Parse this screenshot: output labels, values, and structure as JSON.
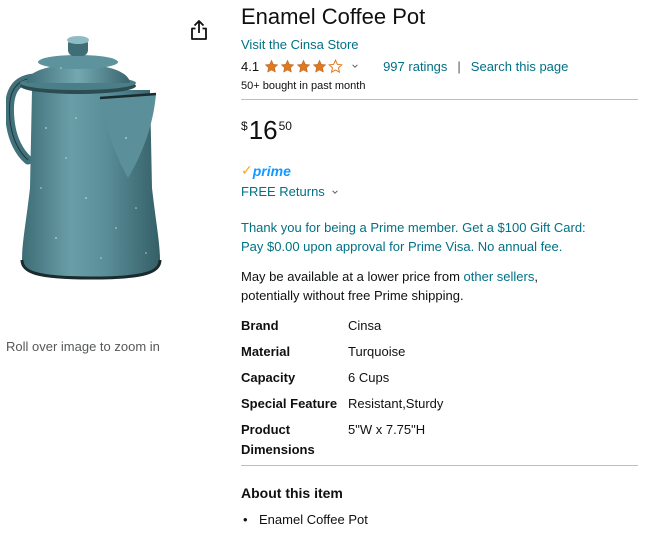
{
  "image_panel": {
    "zoom_hint": "Roll over image to zoom in"
  },
  "product": {
    "title": "Enamel Coffee Pot",
    "store_link": "Visit the Cinsa Store",
    "rating_value": "4.1",
    "rating_stars": 4.1,
    "ratings_count": "997 ratings",
    "search_link": "Search this page",
    "bought_text": "50+ bought in past month",
    "price": {
      "symbol": "$",
      "whole": "16",
      "fraction": "50"
    },
    "prime_label": "prime",
    "returns_label": "FREE Returns",
    "promo_lines": [
      "Thank you for being a Prime member. Get a $100 Gift Card:",
      "Pay $0.00 upon approval for Prime Visa. No annual fee."
    ],
    "lower_price": {
      "prefix": "May be available at a lower price from ",
      "link": "other sellers",
      "suffix": ",",
      "line2": "potentially without free Prime shipping."
    },
    "specs": [
      {
        "label": "Brand",
        "value": "Cinsa"
      },
      {
        "label": "Material",
        "value": "Turquoise"
      },
      {
        "label": "Capacity",
        "value": "6 Cups"
      },
      {
        "label": "Special Feature",
        "value": "Resistant,Sturdy"
      },
      {
        "label_line1": "Product",
        "label_line2": "Dimensions",
        "value": "5\"W x 7.75\"H"
      }
    ],
    "about_title": "About this item",
    "bullets": [
      "Enamel Coffee Pot"
    ]
  },
  "icons": {
    "share": "share-icon",
    "star": "star-icon",
    "chevron": "chevron-down-icon",
    "prime_check": "prime-check-icon"
  },
  "colors": {
    "link": "#007185",
    "star": "#de7921",
    "prime_blue": "#1399ff",
    "prime_check": "#ffa41c",
    "enamel": "#4f8791"
  }
}
